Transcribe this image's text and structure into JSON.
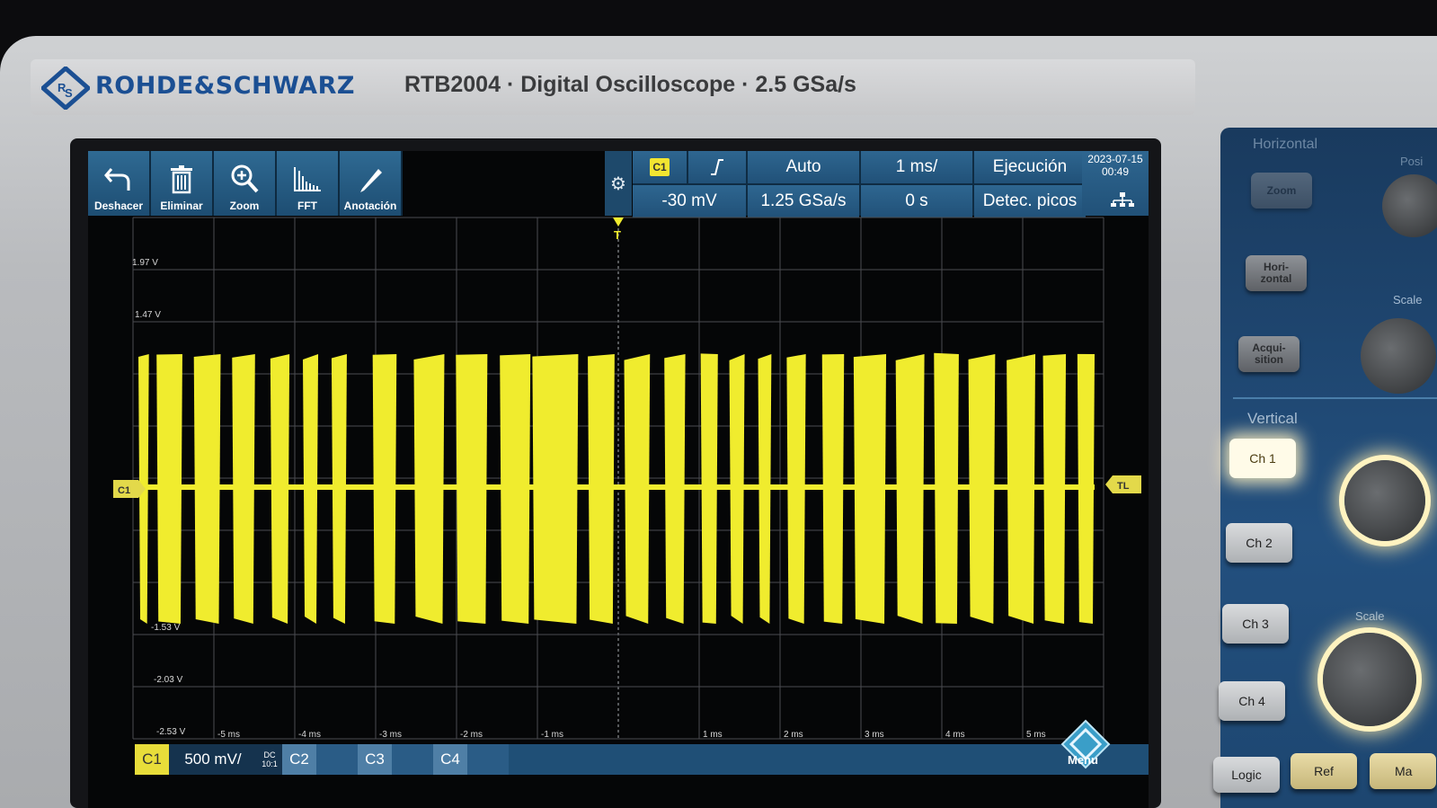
{
  "brand": {
    "name": "ROHDE&SCHWARZ",
    "model_line": "RTB2004 · Digital Oscilloscope · 2.5 GSa/s"
  },
  "toolbar": [
    {
      "label": "Deshacer",
      "icon": "undo-icon"
    },
    {
      "label": "Eliminar",
      "icon": "trash-icon"
    },
    {
      "label": "Zoom",
      "icon": "zoom-icon"
    },
    {
      "label": "FFT",
      "icon": "fft-icon"
    },
    {
      "label": "Anotación",
      "icon": "pencil-icon"
    }
  ],
  "status": {
    "trigger_source": "C1",
    "trigger_level": "-30 mV",
    "trigger_mode": "Auto",
    "sample_rate": "1.25 GSa/s",
    "time_scale": "1 ms/",
    "time_offset": "0 s",
    "run_state": "Ejecución",
    "acq_mode": "Detec. picos",
    "date": "2023-07-15",
    "time": "00:49"
  },
  "plot": {
    "y_labels": [
      "1.97 V",
      "1.47 V",
      "-1.53 V",
      "-2.03 V",
      "-2.53 V"
    ],
    "x_labels": [
      "-5 ms",
      "-4 ms",
      "-3 ms",
      "-2 ms",
      "-1 ms",
      "1 ms",
      "2 ms",
      "3 ms",
      "4 ms",
      "5 ms"
    ],
    "channel_marker": "C1",
    "trigger_level_marker": "TL",
    "trigger_pos_marker": "T",
    "trace_color": "#f0ec2e",
    "bursts": [
      [
        0.0,
        0.11
      ],
      [
        0.19,
        0.46
      ],
      [
        0.58,
        0.86
      ],
      [
        0.98,
        1.22
      ],
      [
        1.38,
        1.58
      ],
      [
        1.72,
        1.88
      ],
      [
        2.02,
        2.18
      ],
      [
        2.45,
        2.7
      ],
      [
        2.88,
        3.2
      ],
      [
        3.32,
        3.65
      ],
      [
        3.78,
        4.1
      ],
      [
        4.12,
        4.6
      ],
      [
        4.7,
        4.98
      ],
      [
        5.08,
        5.35
      ],
      [
        5.5,
        5.72
      ],
      [
        5.88,
        6.06
      ],
      [
        6.18,
        6.34
      ],
      [
        6.48,
        6.62
      ],
      [
        6.78,
        6.98
      ],
      [
        7.15,
        7.38
      ],
      [
        7.48,
        7.82
      ],
      [
        7.92,
        8.22
      ],
      [
        8.32,
        8.58
      ],
      [
        8.68,
        8.96
      ],
      [
        9.08,
        9.38
      ],
      [
        9.46,
        9.7
      ],
      [
        9.82,
        10.0
      ]
    ]
  },
  "bottom_bar": {
    "c1": "C1",
    "c1_scale": "500 mV/",
    "c1_coupling": "DC",
    "c1_probe": "10:1",
    "c2": "C2",
    "c3": "C3",
    "c4": "C4",
    "menu": "Menu"
  },
  "panel": {
    "horizontal_title": "Horizontal",
    "vertical_title": "Vertical",
    "zoom": "Zoom",
    "horizontal": "Hori-\nzontal",
    "acquisition": "Acqui-\nsition",
    "position": "Posi",
    "scale_h": "Scale",
    "scale_v": "Scale",
    "ch1": "Ch 1",
    "ch2": "Ch 2",
    "ch3": "Ch 3",
    "ch4": "Ch 4",
    "logic": "Logic",
    "ref": "Ref",
    "math": "Ma"
  }
}
